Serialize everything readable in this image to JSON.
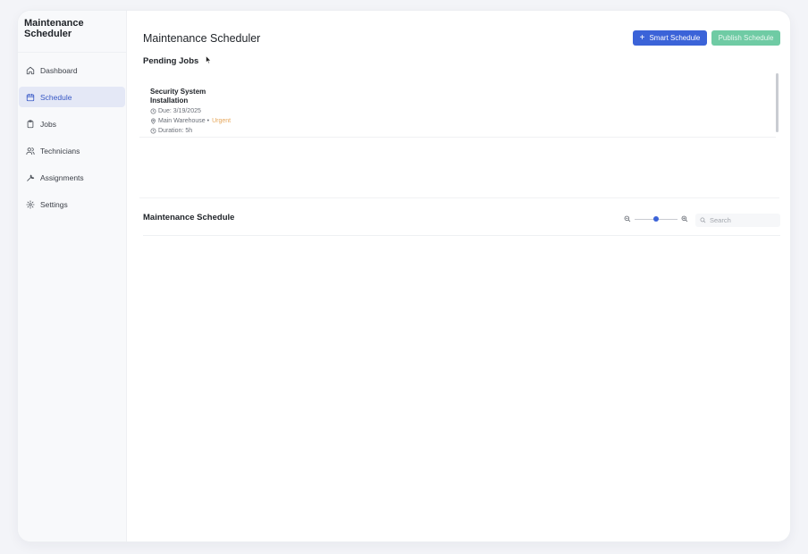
{
  "app": {
    "brand": "Maintenance Scheduler"
  },
  "sidebar": {
    "items": [
      {
        "label": "Dashboard",
        "icon": "home-icon",
        "active": false
      },
      {
        "label": "Schedule",
        "icon": "calendar-icon",
        "active": true
      },
      {
        "label": "Jobs",
        "icon": "clipboard-icon",
        "active": false
      },
      {
        "label": "Technicians",
        "icon": "users-icon",
        "active": false
      },
      {
        "label": "Assignments",
        "icon": "wrench-icon",
        "active": false
      },
      {
        "label": "Settings",
        "icon": "gear-icon",
        "active": false
      }
    ]
  },
  "header": {
    "title": "Maintenance Scheduler",
    "smart_schedule_label": "Smart Schedule",
    "publish_schedule_label": "Publish Schedule"
  },
  "pending": {
    "title": "Pending Jobs",
    "jobs": [
      {
        "title": "Security System Installation",
        "due": "Due: 3/19/2025",
        "location": "Main Warehouse",
        "priority": "Urgent",
        "duration": "Duration: 5h"
      }
    ]
  },
  "schedule": {
    "title": "Maintenance Schedule",
    "zoom_level": 0.5,
    "search_placeholder": "Search"
  },
  "colors": {
    "accent": "#3b63d8",
    "publish": "#6fcba4",
    "priority": "#e6a75c",
    "active_nav_bg": "#e4e8f6"
  }
}
